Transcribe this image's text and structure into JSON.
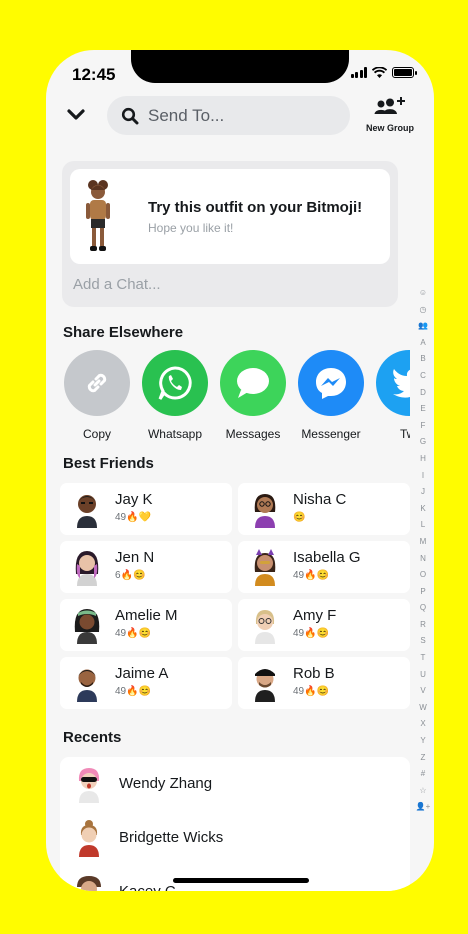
{
  "status": {
    "time": "12:45"
  },
  "header": {
    "search_placeholder": "Send To...",
    "new_group_label": "New Group"
  },
  "share_card": {
    "title": "Try this outfit on your Bitmoji!",
    "subtitle": "Hope you like it!",
    "add_chat_placeholder": "Add a Chat..."
  },
  "share_elsewhere": {
    "heading": "Share Elsewhere",
    "apps": [
      {
        "label": "Copy",
        "icon": "link-icon",
        "color": "#C5C8CC"
      },
      {
        "label": "Whatsapp",
        "icon": "whatsapp-icon",
        "color": "#29C150"
      },
      {
        "label": "Messages",
        "icon": "messages-icon",
        "color": "#3DD45A"
      },
      {
        "label": "Messenger",
        "icon": "messenger-icon",
        "color": "#1E8BF7"
      },
      {
        "label": "Twi",
        "icon": "twitter-icon",
        "color": "#1DA1F2"
      }
    ]
  },
  "best_friends": {
    "heading": "Best Friends",
    "items": [
      {
        "name": "Jay K",
        "score": "49🔥💛"
      },
      {
        "name": "Nisha C",
        "score": "😊"
      },
      {
        "name": "Jen N",
        "score": "6🔥😊"
      },
      {
        "name": "Isabella G",
        "score": "49🔥😊"
      },
      {
        "name": "Amelie M",
        "score": "49🔥😊"
      },
      {
        "name": "Amy F",
        "score": "49🔥😊"
      },
      {
        "name": "Jaime A",
        "score": "49🔥😊"
      },
      {
        "name": "Rob B",
        "score": "49🔥😊"
      }
    ]
  },
  "recents": {
    "heading": "Recents",
    "items": [
      {
        "name": "Wendy Zhang"
      },
      {
        "name": "Bridgette Wicks"
      },
      {
        "name": "Kacey C"
      }
    ]
  },
  "alphabet_index": [
    "☺",
    "◷",
    "👥",
    "A",
    "B",
    "C",
    "D",
    "E",
    "F",
    "G",
    "H",
    "I",
    "J",
    "K",
    "L",
    "M",
    "N",
    "O",
    "P",
    "Q",
    "R",
    "S",
    "T",
    "U",
    "V",
    "W",
    "X",
    "Y",
    "Z",
    "#",
    "☆",
    "👤+"
  ],
  "colors": {
    "brand_yellow": "#FFFC00",
    "background": "#F6F6F6",
    "card": "#FFFFFF"
  }
}
